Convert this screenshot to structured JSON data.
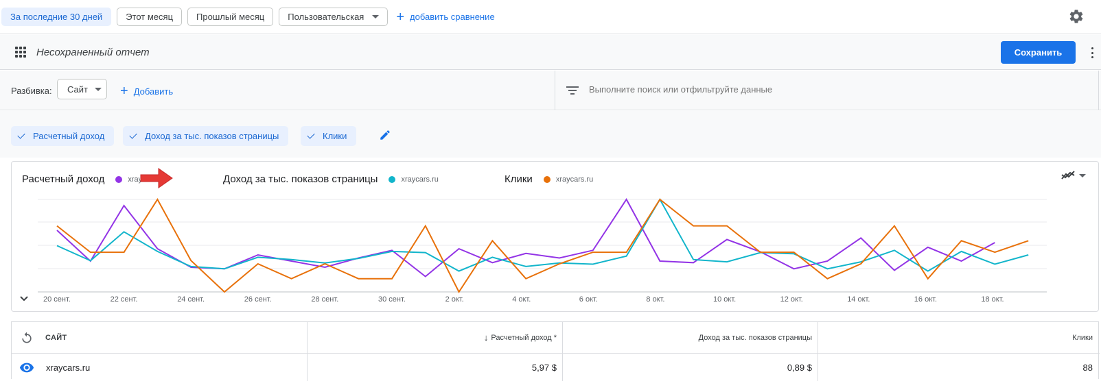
{
  "date_ranges": {
    "last30": "За последние 30 дней",
    "this_month": "Этот месяц",
    "last_month": "Прошлый месяц",
    "custom": "Пользовательская",
    "add_compare": "добавить сравнение"
  },
  "report": {
    "title": "Несохраненный отчет",
    "save": "Сохранить"
  },
  "filter": {
    "split_label": "Разбивка:",
    "dimension": "Сайт",
    "add": "Добавить",
    "search_placeholder": "Выполните поиск или отфильтруйте данные"
  },
  "metrics": {
    "revenue": "Расчетный доход",
    "rpm": "Доход за тыс. показов страницы",
    "clicks": "Клики"
  },
  "chart_legend": {
    "revenue_title": "Расчетный доход",
    "revenue_site": "xraycars.ru",
    "rpm_title": "Доход за тыс. показов страницы",
    "rpm_site": "xraycars.ru",
    "clicks_title": "Клики",
    "clicks_site": "xraycars.ru"
  },
  "colors": {
    "revenue": "#9334e6",
    "rpm": "#12b5cb",
    "clicks": "#e8710a",
    "accent": "#1a73e8"
  },
  "chart_data": {
    "type": "line",
    "tick_labels": [
      "20 сент.",
      "22 сент.",
      "24 сент.",
      "26 сент.",
      "28 сент.",
      "30 сент.",
      "2 окт.",
      "4 окт.",
      "6 окт.",
      "8 окт.",
      "10 окт.",
      "12 окт.",
      "14 окт.",
      "16 окт.",
      "18 окт."
    ],
    "tick_index": [
      0,
      2,
      4,
      6,
      8,
      10,
      12,
      14,
      16,
      18,
      20,
      22,
      24,
      26,
      28
    ],
    "grid": true,
    "series": [
      {
        "name": "xraycars.ru",
        "metric": "revenue",
        "values": [
          2.0,
          1.0,
          2.8,
          1.4,
          0.8,
          0.75,
          1.2,
          1.0,
          0.8,
          1.1,
          1.35,
          0.5,
          1.4,
          0.95,
          1.25,
          1.1,
          1.35,
          3.0,
          1.0,
          0.95,
          1.7,
          1.3,
          0.75,
          1.0,
          1.75,
          0.7,
          1.45,
          1.0,
          1.6
        ]
      },
      {
        "name": "xraycars.ru",
        "metric": "rpm",
        "values": [
          2.0,
          1.35,
          2.6,
          1.75,
          1.1,
          1.0,
          1.5,
          1.4,
          1.25,
          1.45,
          1.75,
          1.7,
          0.9,
          1.5,
          1.1,
          1.25,
          1.2,
          1.55,
          4.0,
          1.4,
          1.3,
          1.7,
          1.65,
          1.0,
          1.3,
          1.8,
          0.9,
          1.75,
          1.2,
          1.6
        ]
      },
      {
        "name": "xraycars.ru",
        "metric": "clicks",
        "values": [
          2.0,
          1.2,
          1.2,
          2.8,
          0.95,
          0.0,
          0.85,
          0.4,
          0.85,
          0.4,
          0.4,
          2.0,
          0.0,
          1.55,
          0.4,
          0.85,
          1.2,
          1.2,
          2.8,
          2.0,
          2.0,
          1.2,
          1.2,
          0.4,
          0.85,
          2.0,
          0.4,
          1.55,
          1.2,
          1.55
        ]
      }
    ]
  },
  "table": {
    "headers": {
      "site": "САЙТ",
      "revenue": "Расчетный доход *",
      "rpm": "Доход за тыс. показов страницы",
      "clicks": "Клики"
    },
    "rows": [
      {
        "site": "xraycars.ru",
        "revenue": "5,97 $",
        "rpm": "0,89 $",
        "clicks": "88"
      }
    ]
  }
}
